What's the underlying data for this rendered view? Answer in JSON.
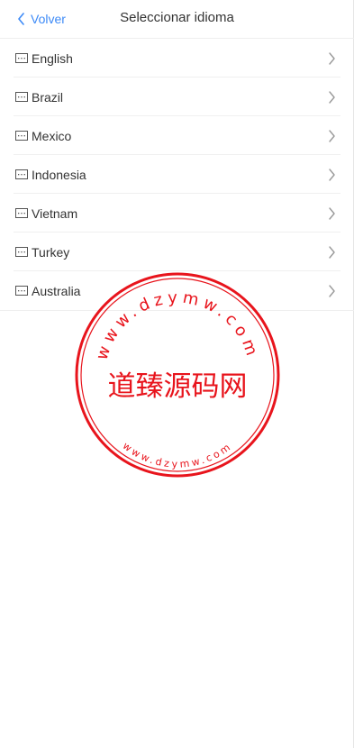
{
  "header": {
    "back_label": "Volver",
    "title": "Seleccionar idioma"
  },
  "languages": [
    {
      "label": "English",
      "icon": "flag-image-placeholder-icon"
    },
    {
      "label": "Brazil",
      "icon": "flag-image-placeholder-icon"
    },
    {
      "label": "Mexico",
      "icon": "flag-image-placeholder-icon"
    },
    {
      "label": "Indonesia",
      "icon": "flag-image-placeholder-icon"
    },
    {
      "label": "Vietnam",
      "icon": "flag-image-placeholder-icon"
    },
    {
      "label": "Turkey",
      "icon": "flag-image-placeholder-icon"
    },
    {
      "label": "Australia",
      "icon": "flag-image-placeholder-icon"
    }
  ],
  "watermark": {
    "center_text": "道臻源码网",
    "outer_text": "www.dzymw.com",
    "inner_text": "www.dzymw.com",
    "color": "#e8141c"
  },
  "colors": {
    "accent": "#3d8af7",
    "text": "#333333",
    "chevron": "#999999"
  }
}
